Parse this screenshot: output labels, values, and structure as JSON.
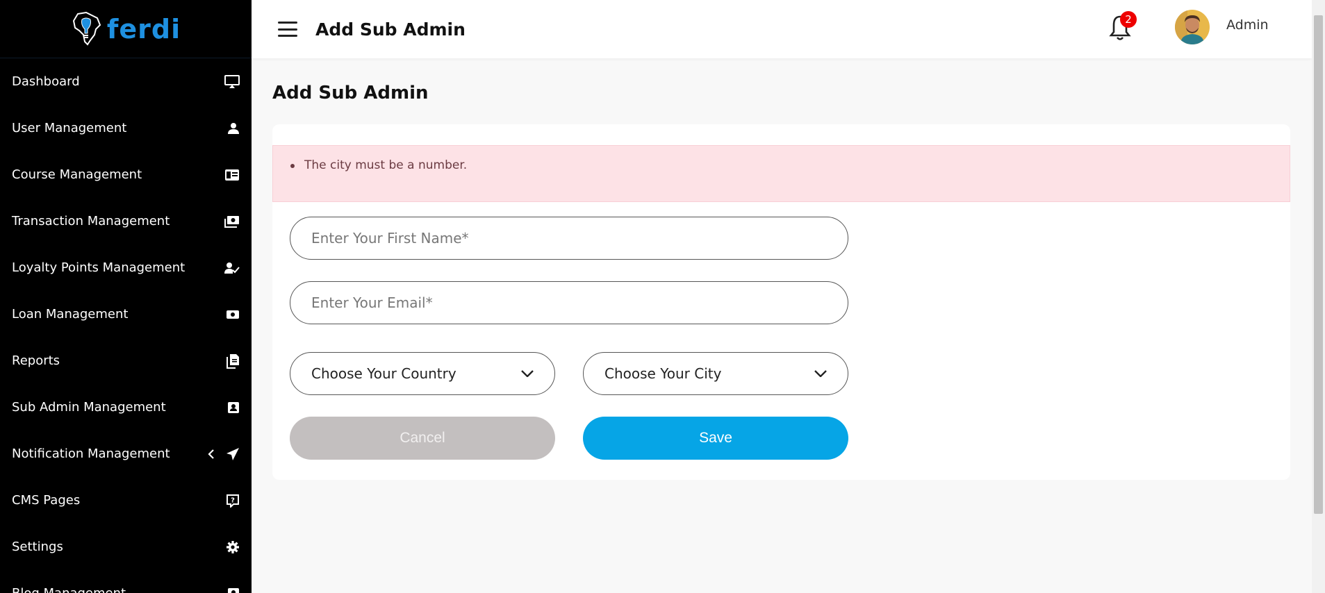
{
  "brand": {
    "name": "ferdi"
  },
  "sidebar": {
    "items": [
      {
        "label": "Dashboard",
        "icon": "monitor-icon"
      },
      {
        "label": "User Management",
        "icon": "user-icon"
      },
      {
        "label": "Course Management",
        "icon": "id-card-icon"
      },
      {
        "label": "Transaction Management",
        "icon": "money-icon"
      },
      {
        "label": "Loyalty Points Management",
        "icon": "user-check-icon"
      },
      {
        "label": "Loan Management",
        "icon": "cash-icon"
      },
      {
        "label": "Reports",
        "icon": "document-icon"
      },
      {
        "label": "Sub Admin Management",
        "icon": "contact-card-icon"
      },
      {
        "label": "Notification Management",
        "icon": "paper-plane-icon"
      },
      {
        "label": "CMS Pages",
        "icon": "help-box-icon"
      },
      {
        "label": "Settings",
        "icon": "gear-icon"
      },
      {
        "label": "Blog Management",
        "icon": "blog-icon"
      }
    ]
  },
  "header": {
    "title": "Add Sub Admin",
    "notification_count": "2",
    "user_name": "Admin"
  },
  "main": {
    "page_title": "Add Sub Admin",
    "alert": {
      "message": "The city must be a number."
    },
    "form": {
      "first_name_placeholder": "Enter Your First Name*",
      "email_placeholder": "Enter Your Email*",
      "country_select": "Choose Your Country",
      "city_select": "Choose Your City",
      "cancel_label": "Cancel",
      "save_label": "Save"
    }
  },
  "colors": {
    "sidebar_bg": "#000000",
    "brand": "#1e90e0",
    "save_button": "#06a5e6",
    "cancel_button": "#c3bfbf",
    "alert_bg": "#fde2e6",
    "badge": "#ee0000"
  }
}
